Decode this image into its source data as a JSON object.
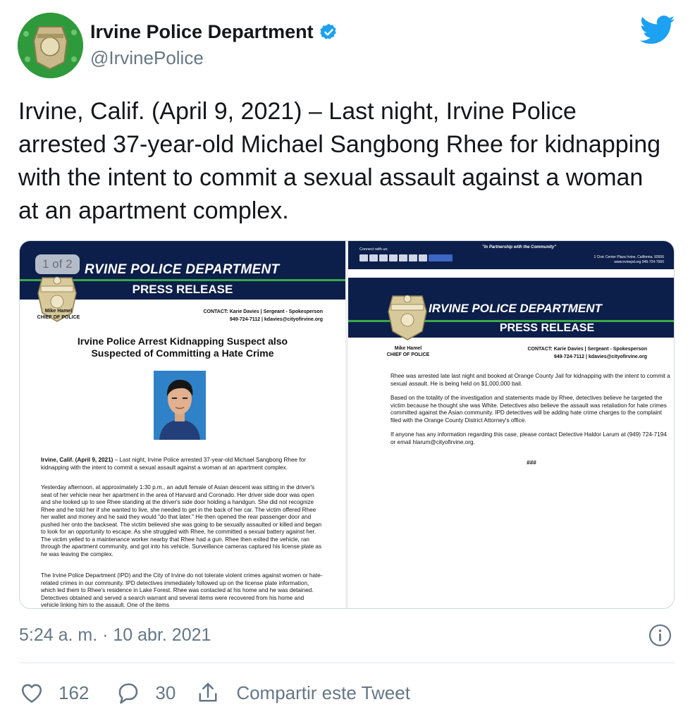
{
  "author": {
    "display_name": "Irvine Police Department",
    "handle": "@IrvinePolice"
  },
  "tweet": {
    "text": "Irvine, Calif. (April 9, 2021) – Last night, Irvine Police arrested 37-year-old Michael Sangbong Rhee for kidnapping with the intent to commit a sexual assault against a woman at an apartment complex.",
    "timestamp": "5:24 a. m. · 10 abr. 2021"
  },
  "media": {
    "counter": "1 of 2",
    "page1": {
      "dept_title": "RVINE POLICE DEPARTMENT",
      "press_release": "PRESS RELEASE",
      "chief_name": "Mike Hamel",
      "chief_title": "CHIEF OF POLICE",
      "contact_line1": "CONTACT: Karie Davies | Sergeant - Spokesperson",
      "contact_line2": "949-724-7112 | kdavies@cityofirvine.org",
      "release_title_1": "Irvine Police Arrest Kidnapping Suspect also",
      "release_title_2": "Suspected of Committing a Hate Crime",
      "para1_lead": "Irvine, Calif. (April 9, 2021)",
      "para1": " – Last night, Irvine Police arrested 37-year-old Michael Sangbong Rhee for kidnapping with the intent to commit a sexual assault against a woman at an apartment complex.",
      "para2": "Yesterday afternoon, at approximately 1:30 p.m., an adult female of Asian descent was sitting in the driver's seat of her vehicle near her apartment in the area of Harvard and Coronado. Her driver side door was open and she looked up to see Rhee standing at the driver's side door holding a handgun. She did not recognize Rhee and he told her if she wanted to live, she needed to get in the back of her car. The victim offered Rhee her wallet and money and he said they would \"do that later.\" He then opened the rear passenger door and pushed her onto the backseat. The victim believed she was going to be sexually assaulted or killed and began to look for an opportunity to escape. As she struggled with Rhee, he committed a sexual battery against her. The victim yelled to a maintenance worker nearby that Rhee had a gun. Rhee then exited the vehicle, ran through the apartment community, and got into his vehicle. Surveillance cameras captured his license plate as he was leaving the complex.",
      "para3": "The Irvine Police Department (IPD) and the City of Irvine do not tolerate violent crimes against women or hate-related crimes in our community. IPD detectives immediately followed up on the license plate information, which led them to Rhee's residence in Lake Forest. Rhee was contacted at his home and he was detained. Detectives obtained and served a search warrant and several items were recovered from his home and vehicle linking him to the assault. One of the items"
    },
    "page2": {
      "connect": "Connect with us:",
      "partnership": "\"In Partnership with the Community\"",
      "address_1": "1 Civic Center Plaza Irvine, California, 92606",
      "address_2": "www.irvinepd.org 949-724-7000",
      "dept_title": "IRVINE POLICE DEPARTMENT",
      "press_release": "PRESS RELEASE",
      "chief_name": "Mike Hamel",
      "chief_title": "CHIEF OF POLICE",
      "contact_line1": "CONTACT: Karie Davies | Sergeant - Spokesperson",
      "contact_line2": "949-724-7112 | kdavies@cityofirvine.org",
      "para1": "Rhee was arrested late last night and booked at Orange County Jail for kidnapping with the intent to commit a sexual assault. He is being held on $1,000,000 bail.",
      "para2": "Based on the totality of the investigation and statements made by Rhee, detectives believe he targeted the victim because he thought she was White. Detectives also believe the assault was retaliation for hate crimes committed against the Asian community. IPD detectives will be adding hate crime charges to the complaint filed with the Orange County District Attorney's office.",
      "para3": "If anyone has any information regarding this case, please contact Detective Haldor Larum at (949) 724-7194 or email hlarum@cityofirvine.org.",
      "end_mark": "###"
    }
  },
  "actions": {
    "likes": "162",
    "replies": "30",
    "share_label": "Compartir este Tweet"
  },
  "colors": {
    "twitter_blue": "#1da1f2",
    "navy": "#0c1e4a",
    "secondary_text": "#657786"
  }
}
